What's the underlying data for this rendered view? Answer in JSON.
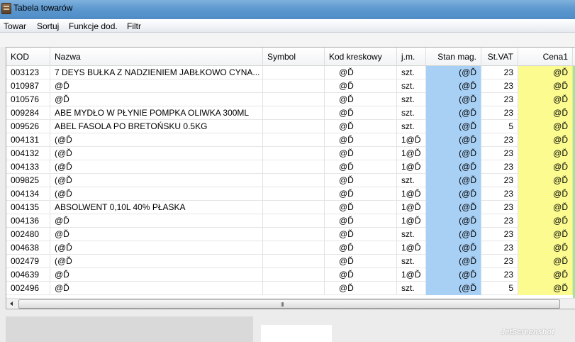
{
  "window": {
    "title": "Tabela towarów"
  },
  "menu": [
    {
      "label": "Towar"
    },
    {
      "label": "Sortuj"
    },
    {
      "label": "Funkcje dod."
    },
    {
      "label": "Filtr"
    }
  ],
  "table": {
    "columns": [
      {
        "key": "kod",
        "label": "KOD"
      },
      {
        "key": "nazwa",
        "label": "Nazwa"
      },
      {
        "key": "symbol",
        "label": "Symbol"
      },
      {
        "key": "kod_kreskowy",
        "label": "Kod kreskowy"
      },
      {
        "key": "jm",
        "label": "j.m."
      },
      {
        "key": "stan",
        "label": "Stan mag."
      },
      {
        "key": "vat",
        "label": "St.VAT"
      },
      {
        "key": "cena1",
        "label": "Cena1"
      }
    ],
    "rows": [
      {
        "kod": "003123",
        "nazwa": "7 DEYS BUŁKA Z NADZIENIEM JABŁKOWO CYNA...",
        "symbol": "",
        "kod_kreskowy": "@Ď",
        "jm": "szt.",
        "stan": "(@Ď",
        "vat": "23",
        "cena1": "@Ď"
      },
      {
        "kod": "010987",
        "nazwa": " @Ď",
        "symbol": "",
        "kod_kreskowy": "@Ď",
        "jm": "szt.",
        "stan": "(@Ď",
        "vat": "23",
        "cena1": "@Ď"
      },
      {
        "kod": "010576",
        "nazwa": " @Ď",
        "symbol": "",
        "kod_kreskowy": "@Ď",
        "jm": "szt.",
        "stan": "(@Ď",
        "vat": "23",
        "cena1": "@Ď"
      },
      {
        "kod": "009284",
        "nazwa": "ABE MYDŁO W PŁYNIE POMPKA OLIWKA 300ML",
        "symbol": "",
        "kod_kreskowy": "@Ď",
        "jm": "szt.",
        "stan": "(@Ď",
        "vat": "23",
        "cena1": "@Ď"
      },
      {
        "kod": "009526",
        "nazwa": "ABEL FASOLA PO BRETOŃSKU 0.5KG",
        "symbol": "",
        "kod_kreskowy": "@Ď",
        "jm": "szt.",
        "stan": "(@Ď",
        "vat": "5",
        "cena1": "@Ď"
      },
      {
        "kod": "004131",
        "nazwa": "(@Ď",
        "symbol": "",
        "kod_kreskowy": "@Ď",
        "jm": "1@Ď",
        "stan": "(@Ď",
        "vat": "23",
        "cena1": "@Ď"
      },
      {
        "kod": "004132",
        "nazwa": "(@Ď",
        "symbol": "",
        "kod_kreskowy": "@Ď",
        "jm": "1@Ď",
        "stan": "(@Ď",
        "vat": "23",
        "cena1": "@Ď"
      },
      {
        "kod": "004133",
        "nazwa": "(@Ď",
        "symbol": "",
        "kod_kreskowy": "@Ď",
        "jm": "1@Ď",
        "stan": "(@Ď",
        "vat": "23",
        "cena1": "@Ď"
      },
      {
        "kod": "009825",
        "nazwa": "(@Ď",
        "symbol": "",
        "kod_kreskowy": "@Ď",
        "jm": "szt.",
        "stan": "(@Ď",
        "vat": "23",
        "cena1": "@Ď"
      },
      {
        "kod": "004134",
        "nazwa": "(@Ď",
        "symbol": "",
        "kod_kreskowy": "@Ď",
        "jm": "1@Ď",
        "stan": "(@Ď",
        "vat": "23",
        "cena1": "@Ď"
      },
      {
        "kod": "004135",
        "nazwa": "ABSOLWENT 0,10L 40% PŁASKA",
        "symbol": "",
        "kod_kreskowy": "@Ď",
        "jm": "1@Ď",
        "stan": "(@Ď",
        "vat": "23",
        "cena1": "@Ď"
      },
      {
        "kod": "004136",
        "nazwa": " @Ď",
        "symbol": "",
        "kod_kreskowy": "@Ď",
        "jm": "1@Ď",
        "stan": "(@Ď",
        "vat": "23",
        "cena1": "@Ď"
      },
      {
        "kod": "002480",
        "nazwa": " @Ď",
        "symbol": "",
        "kod_kreskowy": "@Ď",
        "jm": "szt.",
        "stan": "(@Ď",
        "vat": "23",
        "cena1": "@Ď"
      },
      {
        "kod": "004638",
        "nazwa": "(@Ď",
        "symbol": "",
        "kod_kreskowy": "@Ď",
        "jm": "1@Ď",
        "stan": "(@Ď",
        "vat": "23",
        "cena1": "@Ď"
      },
      {
        "kod": "002479",
        "nazwa": "(@Ď",
        "symbol": "",
        "kod_kreskowy": "@Ď",
        "jm": "szt.",
        "stan": "(@Ď",
        "vat": "23",
        "cena1": "@Ď"
      },
      {
        "kod": "004639",
        "nazwa": " @Ď",
        "symbol": "",
        "kod_kreskowy": "@Ď",
        "jm": "1@Ď",
        "stan": "(@Ď",
        "vat": "23",
        "cena1": "@Ď"
      },
      {
        "kod": "002496",
        "nazwa": " @Ď",
        "symbol": "",
        "kod_kreskowy": "@Ď",
        "jm": "szt.",
        "stan": "(@Ď",
        "vat": "5",
        "cena1": "@Ď"
      }
    ]
  },
  "scrollbar": {
    "grip": "III"
  },
  "watermark": "JetScreenshot",
  "colors": {
    "stan_bg": "#a8d0f5",
    "cena_bg": "#fbfb90",
    "next_col_bg": "#9ee79a"
  }
}
